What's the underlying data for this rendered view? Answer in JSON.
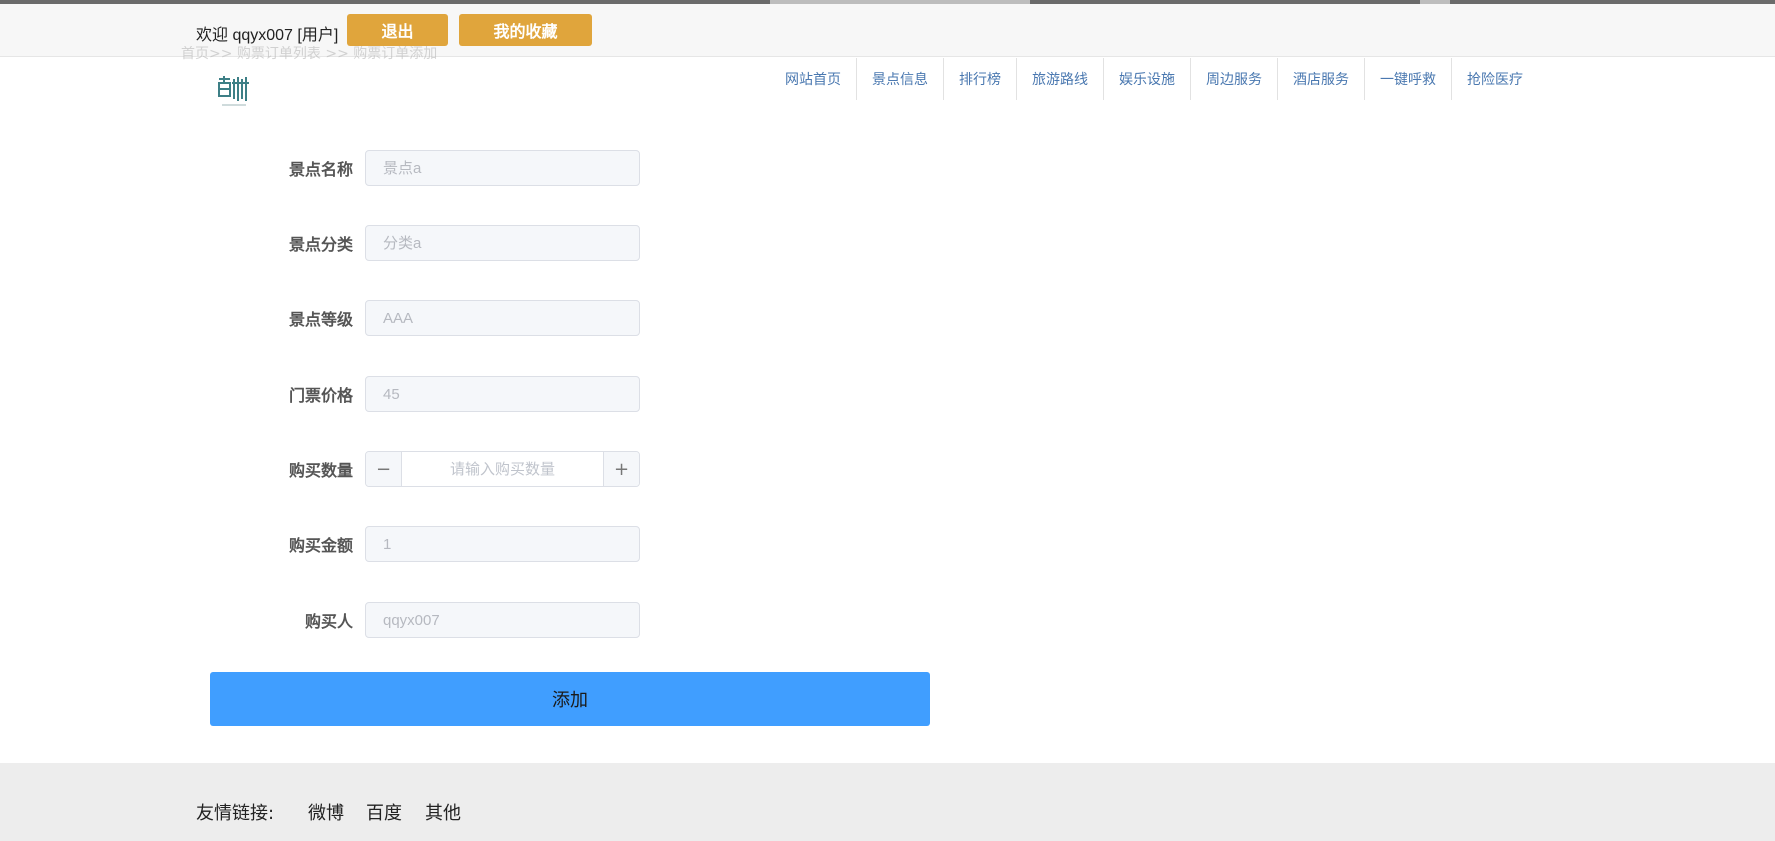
{
  "header": {
    "welcome_text": "欢迎 qqyx007 [用户]",
    "logout_label": "退出",
    "favorites_label": "我的收藏",
    "breadcrumb": "首页>> 购票订单列表 >> 购票订单添加"
  },
  "nav": {
    "items": [
      "网站首页",
      "景点信息",
      "排行榜",
      "旅游路线",
      "娱乐设施",
      "周边服务",
      "酒店服务",
      "一键呼救",
      "抢险医疗"
    ]
  },
  "form": {
    "fields": [
      {
        "label": "景点名称",
        "placeholder": "景点a"
      },
      {
        "label": "景点分类",
        "placeholder": "分类a"
      },
      {
        "label": "景点等级",
        "placeholder": "AAA"
      },
      {
        "label": "门票价格",
        "placeholder": "45"
      },
      {
        "label": "购买数量",
        "placeholder": "请输入购买数量"
      },
      {
        "label": "购买金额",
        "placeholder": "1"
      },
      {
        "label": "购买人",
        "placeholder": "qqyx007"
      }
    ],
    "minus_symbol": "−",
    "plus_symbol": "+",
    "submit_label": "添加"
  },
  "footer": {
    "label": "友情链接:",
    "links": [
      "微博",
      "百度",
      "其他"
    ]
  },
  "colors": {
    "accent_orange": "#e0a53c",
    "primary_blue": "#409eff",
    "nav_link": "#4a78b0",
    "footer_bg": "#ededed"
  },
  "icons": {
    "logo": "logo-icon"
  }
}
